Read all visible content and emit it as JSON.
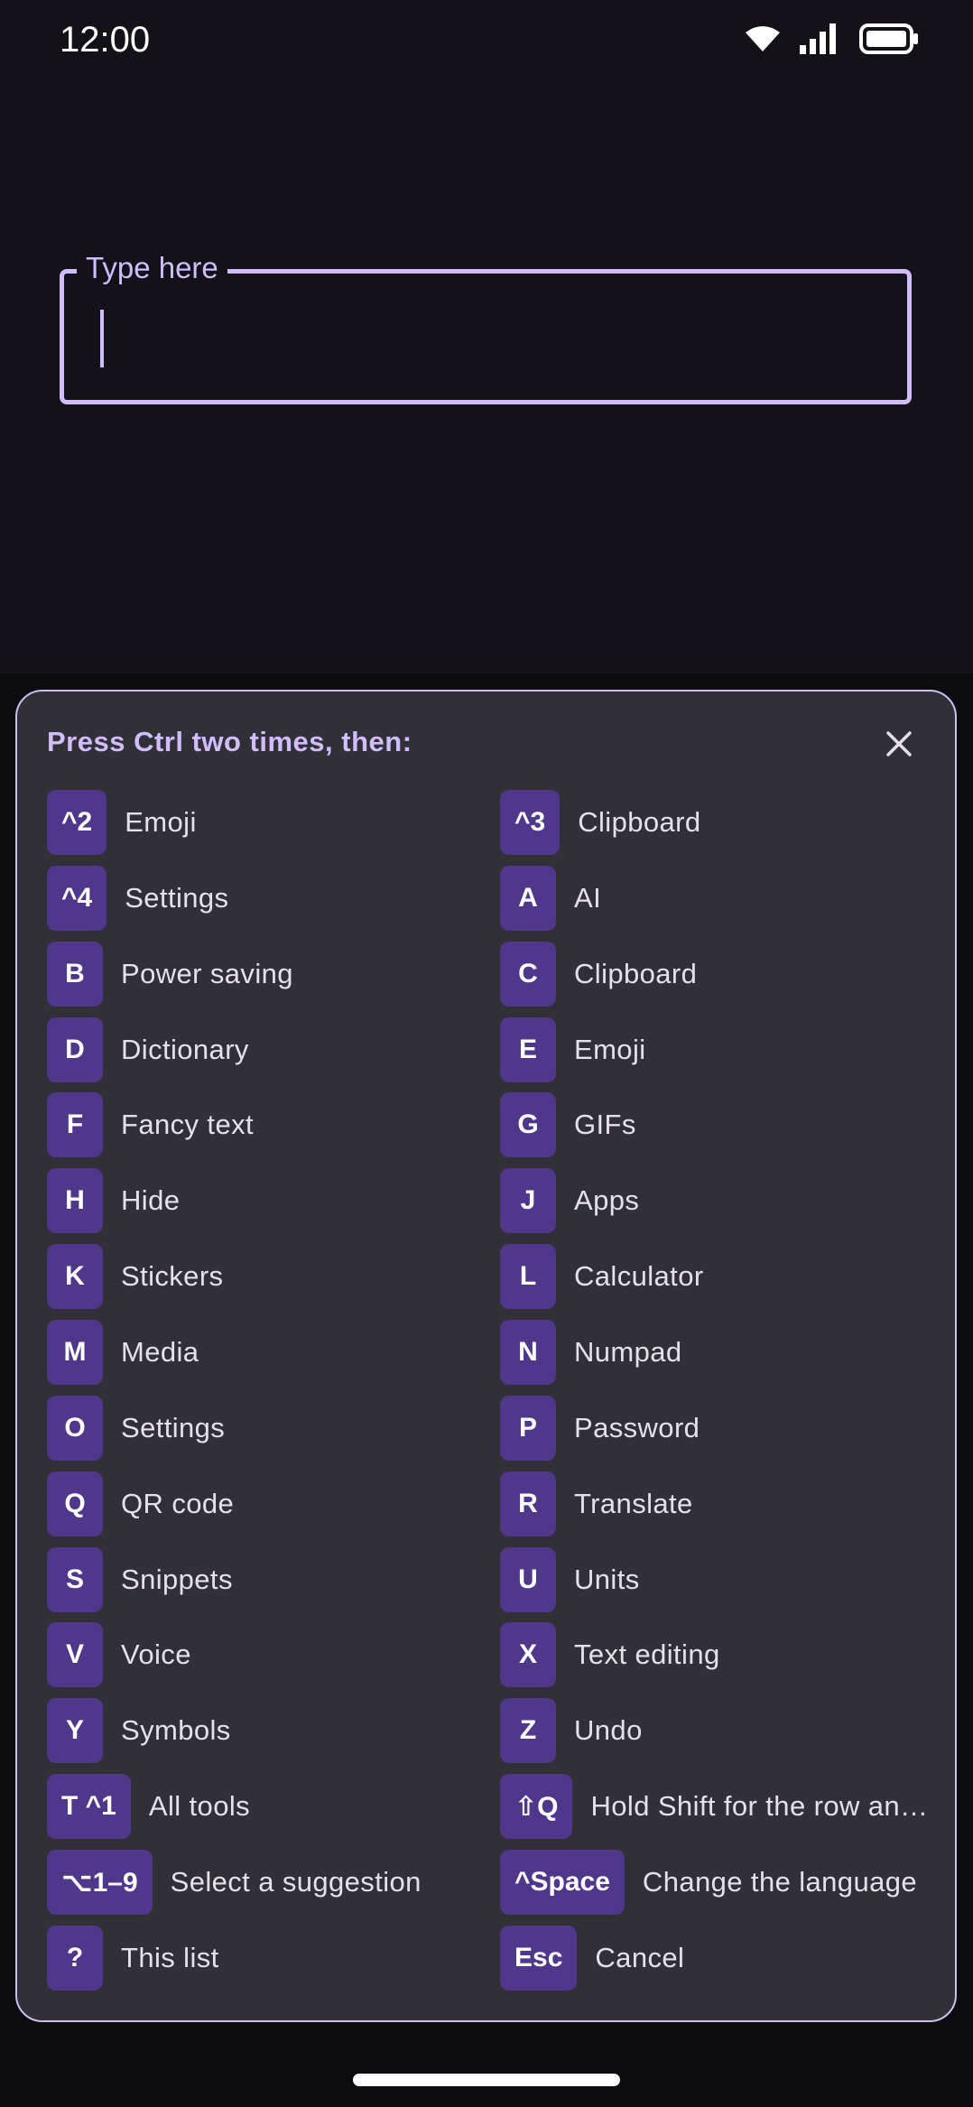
{
  "status_bar": {
    "time": "12:00"
  },
  "text_field": {
    "label": "Type here",
    "value": ""
  },
  "sheet": {
    "title": "Press Ctrl two times, then:",
    "shortcuts": [
      {
        "key": "^2",
        "label": "Emoji"
      },
      {
        "key": "^3",
        "label": "Clipboard"
      },
      {
        "key": "^4",
        "label": "Settings"
      },
      {
        "key": "A",
        "label": "AI"
      },
      {
        "key": "B",
        "label": "Power saving"
      },
      {
        "key": "C",
        "label": "Clipboard"
      },
      {
        "key": "D",
        "label": "Dictionary"
      },
      {
        "key": "E",
        "label": "Emoji"
      },
      {
        "key": "F",
        "label": "Fancy text"
      },
      {
        "key": "G",
        "label": "GIFs"
      },
      {
        "key": "H",
        "label": "Hide"
      },
      {
        "key": "J",
        "label": "Apps"
      },
      {
        "key": "K",
        "label": "Stickers"
      },
      {
        "key": "L",
        "label": "Calculator"
      },
      {
        "key": "M",
        "label": "Media"
      },
      {
        "key": "N",
        "label": "Numpad"
      },
      {
        "key": "O",
        "label": "Settings"
      },
      {
        "key": "P",
        "label": "Password"
      },
      {
        "key": "Q",
        "label": "QR code"
      },
      {
        "key": "R",
        "label": "Translate"
      },
      {
        "key": "S",
        "label": "Snippets"
      },
      {
        "key": "U",
        "label": "Units"
      },
      {
        "key": "V",
        "label": "Voice"
      },
      {
        "key": "X",
        "label": "Text editing"
      },
      {
        "key": "Y",
        "label": "Symbols"
      },
      {
        "key": "Z",
        "label": "Undo"
      },
      {
        "key": "T  ^1",
        "label": "All tools"
      },
      {
        "key": "⇧Q",
        "label": "Hold Shift for the row and column"
      },
      {
        "key": "⌥1–9",
        "label": "Select a suggestion"
      },
      {
        "key": "^Space",
        "label": "Change the language"
      },
      {
        "key": "?",
        "label": "This list"
      },
      {
        "key": "Esc",
        "label": "Cancel"
      }
    ]
  },
  "colors": {
    "background": "#141218",
    "accent": "#d0bcff",
    "key_background": "#4f378b",
    "sheet_background": "#323037"
  }
}
